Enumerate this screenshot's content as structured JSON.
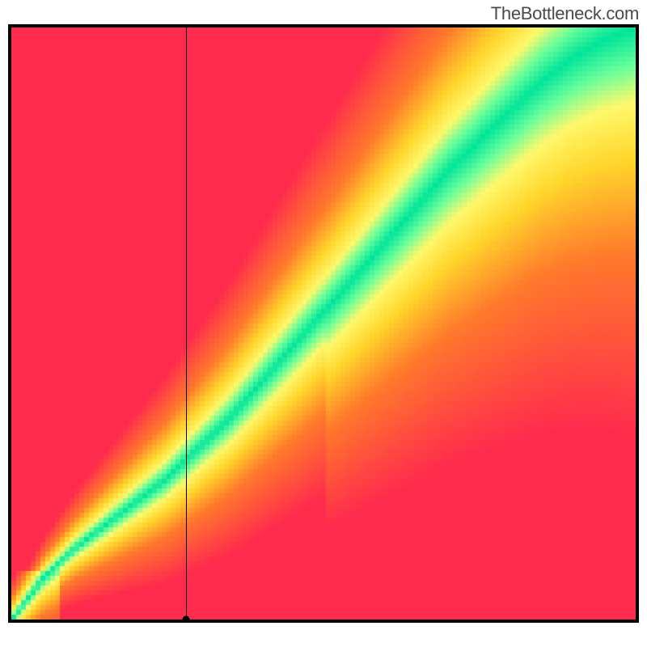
{
  "watermark": "TheBottleneck.com",
  "chart_data": {
    "type": "heatmap",
    "title": "",
    "xlabel": "",
    "ylabel": "",
    "xlim": [
      0,
      100
    ],
    "ylim": [
      0,
      100
    ],
    "grid": false,
    "legend": false,
    "crosshair": {
      "x": 28,
      "y": 0
    },
    "optimal_curve_description": "diagonal ridge from bottom-left to top-right; slightly concave near origin",
    "heat_colors": {
      "worst": "#ff2b4d",
      "bad": "#ff7a2b",
      "warn": "#ffd52b",
      "near": "#fff86b",
      "good": "#6bff9a",
      "best": "#00e59a"
    },
    "ridge_samples": [
      {
        "x": 0,
        "y": 0
      },
      {
        "x": 5,
        "y": 7
      },
      {
        "x": 10,
        "y": 12
      },
      {
        "x": 15,
        "y": 16
      },
      {
        "x": 20,
        "y": 20
      },
      {
        "x": 25,
        "y": 24
      },
      {
        "x": 30,
        "y": 29
      },
      {
        "x": 35,
        "y": 34
      },
      {
        "x": 40,
        "y": 40
      },
      {
        "x": 45,
        "y": 46
      },
      {
        "x": 50,
        "y": 52
      },
      {
        "x": 55,
        "y": 58
      },
      {
        "x": 60,
        "y": 64
      },
      {
        "x": 65,
        "y": 70
      },
      {
        "x": 70,
        "y": 76
      },
      {
        "x": 75,
        "y": 81
      },
      {
        "x": 80,
        "y": 86
      },
      {
        "x": 85,
        "y": 91
      },
      {
        "x": 90,
        "y": 95
      },
      {
        "x": 95,
        "y": 98
      },
      {
        "x": 100,
        "y": 100
      }
    ],
    "ridge_width_fraction": 0.06
  }
}
